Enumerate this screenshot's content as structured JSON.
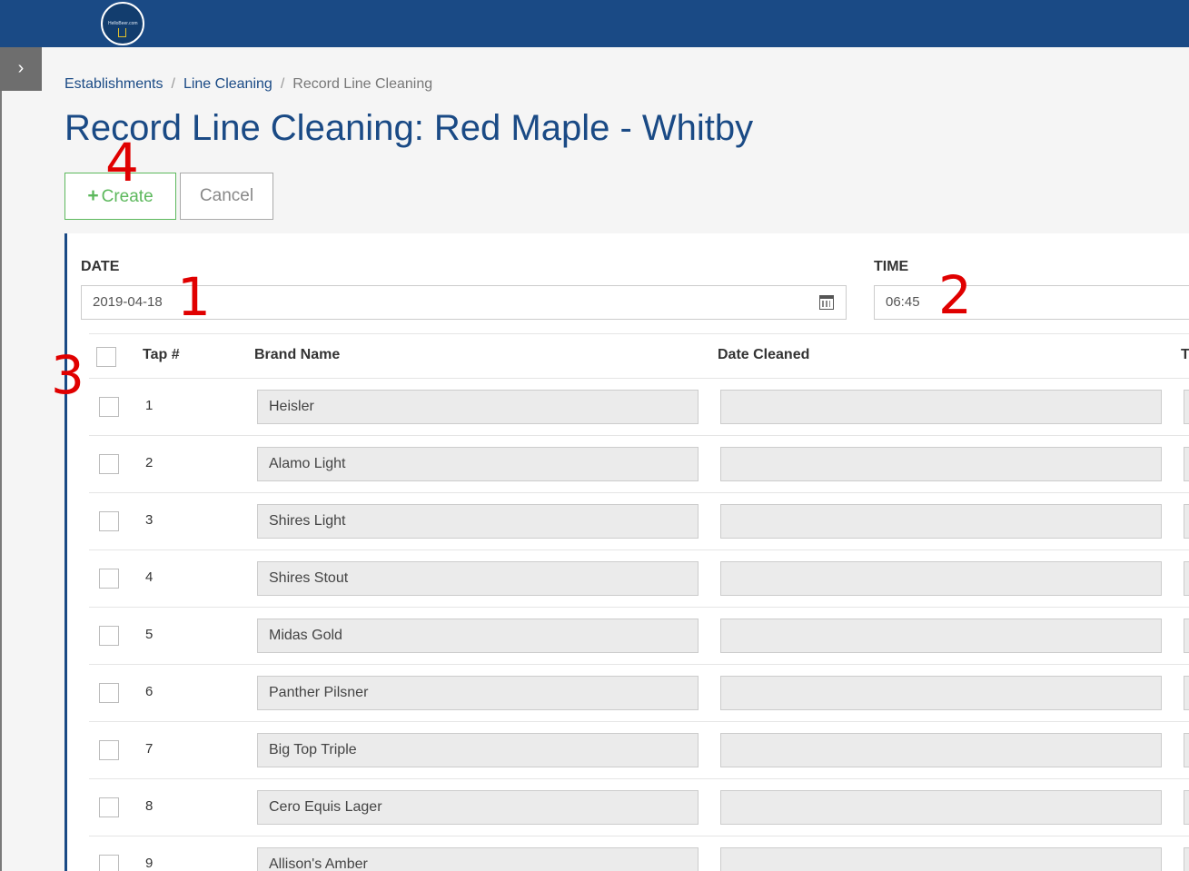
{
  "header": {
    "logo_text": "HelloBeer.com",
    "sidebar_toggle_glyph": "›"
  },
  "breadcrumb": {
    "items": [
      "Establishments",
      "Line Cleaning"
    ],
    "separator": "/",
    "current": "Record Line Cleaning"
  },
  "page_title": "Record Line Cleaning: Red Maple - Whitby",
  "actions": {
    "create_label": "Create",
    "create_icon": "+",
    "cancel_label": "Cancel"
  },
  "form": {
    "date_label": "DATE",
    "date_value": "2019-04-18",
    "time_label": "TIME",
    "time_value": "06:45"
  },
  "table": {
    "columns": [
      "Tap #",
      "Brand Name",
      "Date Cleaned",
      "T"
    ],
    "rows": [
      {
        "tap": "1",
        "brand": "Heisler",
        "date_cleaned": ""
      },
      {
        "tap": "2",
        "brand": "Alamo Light",
        "date_cleaned": ""
      },
      {
        "tap": "3",
        "brand": "Shires Light",
        "date_cleaned": ""
      },
      {
        "tap": "4",
        "brand": "Shires Stout",
        "date_cleaned": ""
      },
      {
        "tap": "5",
        "brand": "Midas Gold",
        "date_cleaned": ""
      },
      {
        "tap": "6",
        "brand": "Panther Pilsner",
        "date_cleaned": ""
      },
      {
        "tap": "7",
        "brand": "Big Top Triple",
        "date_cleaned": ""
      },
      {
        "tap": "8",
        "brand": "Cero Equis Lager",
        "date_cleaned": ""
      },
      {
        "tap": "9",
        "brand": "Allison's Amber",
        "date_cleaned": ""
      }
    ]
  },
  "annotations": {
    "date_marker": "1",
    "time_marker": "2",
    "select_all_marker": "3",
    "create_marker": "4"
  },
  "colors": {
    "brand_blue": "#1a4a85",
    "create_green": "#5cb85c",
    "annotation_red": "#e00000"
  }
}
